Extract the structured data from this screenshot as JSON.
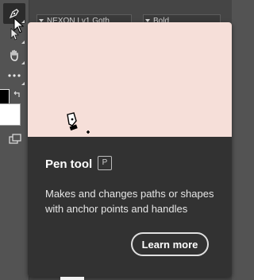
{
  "options_bar": {
    "font_family": "NEXON Lv1 Goth",
    "font_style": "Bold"
  },
  "tooltip": {
    "title": "Pen tool",
    "shortcut": "P",
    "description": "Makes and changes paths or shapes with anchor points and handles",
    "learn_more_label": "Learn more",
    "preview_color": "#f6dfd9"
  },
  "toolbar": {
    "tools": [
      {
        "icon": "pen-icon",
        "active": true
      },
      {
        "icon": "path-selection-icon"
      },
      {
        "icon": "hand-icon"
      },
      {
        "icon": "more-tools-icon"
      }
    ],
    "foreground_color": "#000000",
    "background_color": "#ffffff"
  }
}
